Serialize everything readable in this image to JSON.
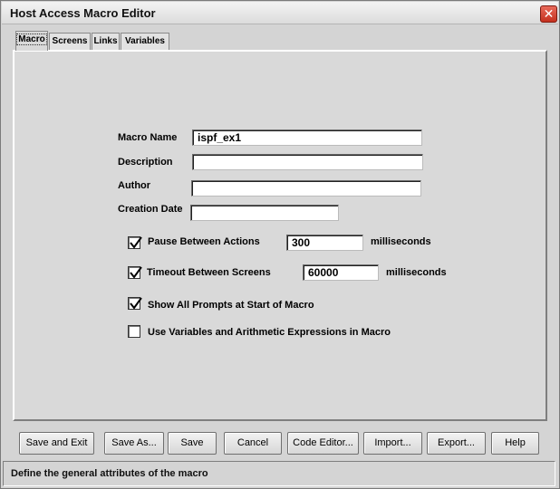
{
  "window": {
    "title": "Host Access Macro Editor"
  },
  "tabs": [
    {
      "label": "Macro",
      "active": true
    },
    {
      "label": "Screens",
      "active": false
    },
    {
      "label": "Links",
      "active": false
    },
    {
      "label": "Variables",
      "active": false
    }
  ],
  "form": {
    "macro_name": {
      "label": "Macro Name",
      "value": "ispf_ex1"
    },
    "description": {
      "label": "Description",
      "value": ""
    },
    "author": {
      "label": "Author",
      "value": ""
    },
    "creation_date": {
      "label": "Creation Date",
      "value": ""
    },
    "pause": {
      "label": "Pause Between Actions",
      "checked": true,
      "value": "300",
      "unit": "milliseconds"
    },
    "timeout": {
      "label": "Timeout Between Screens",
      "checked": true,
      "value": "60000",
      "unit": "milliseconds"
    },
    "show_prompts": {
      "label": "Show All Prompts at Start of Macro",
      "checked": true
    },
    "use_variables": {
      "label": "Use Variables and Arithmetic Expressions in Macro",
      "checked": false
    }
  },
  "buttons": {
    "save_and_exit": "Save and Exit",
    "save_as": "Save As...",
    "save": "Save",
    "cancel": "Cancel",
    "code_editor": "Code Editor...",
    "import": "Import...",
    "export": "Export...",
    "help": "Help"
  },
  "status": {
    "text": "Define the general attributes of the macro"
  },
  "icons": {
    "close": "close-icon",
    "check": "checkmark-icon"
  },
  "colors": {
    "close_button": "#c5301e",
    "window_bg": "#d4d4d4"
  }
}
